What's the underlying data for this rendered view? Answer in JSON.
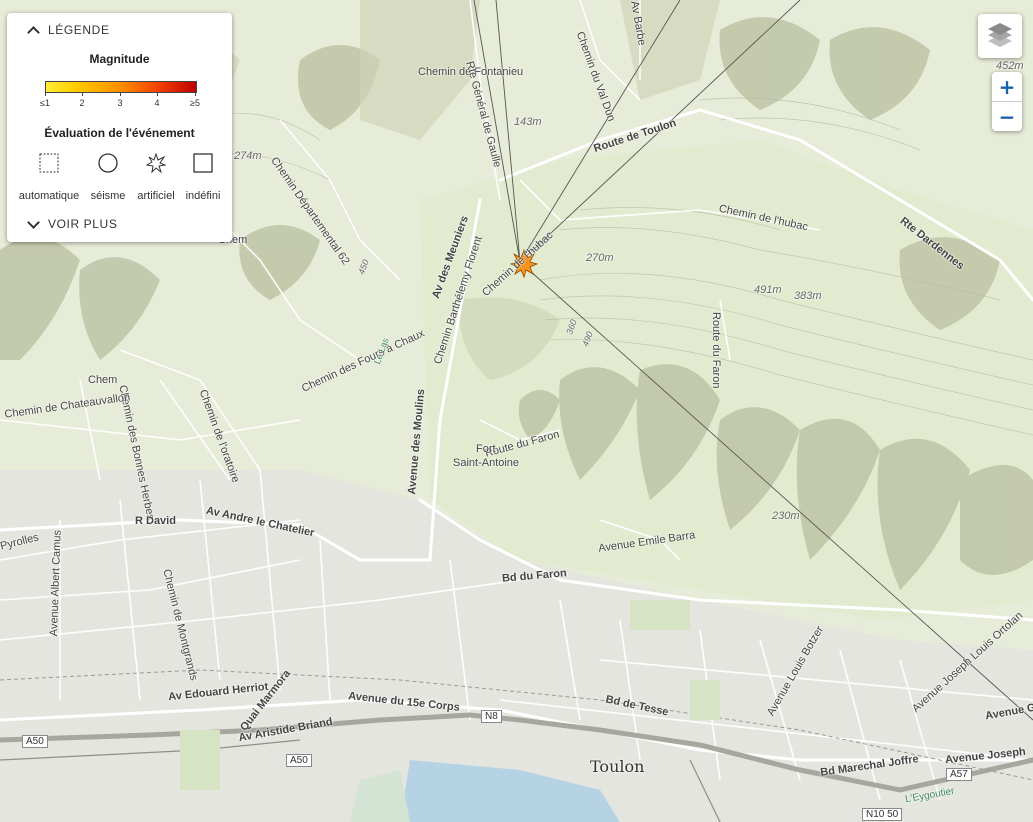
{
  "legend": {
    "toggle_label": "LÉGENDE",
    "magnitude_title": "Magnitude",
    "magnitude_ticks": [
      "≤1",
      "2",
      "3",
      "4",
      "≥5"
    ],
    "evaluation_title": "Évaluation de l'événement",
    "event_types": [
      {
        "label": "automatique",
        "icon": "dotted-square-icon"
      },
      {
        "label": "séisme",
        "icon": "circle-icon"
      },
      {
        "label": "artificiel",
        "icon": "explosion-star-icon"
      },
      {
        "label": "indéfini",
        "icon": "square-icon"
      }
    ],
    "more_label": "VOIR PLUS",
    "colors": {
      "mag_low": "#ffee33",
      "mag_high": "#c00000"
    }
  },
  "controls": {
    "zoom_in": "+",
    "zoom_out": "−",
    "layers_icon": "layers-icon"
  },
  "event": {
    "magnitude": 2.5,
    "type": "artificiel",
    "color": "#f7941d"
  },
  "map_labels": {
    "roads": [
      "Chemin de Fontanieu",
      "Rte Général de Gaulle",
      "Chemin du Val Dun",
      "Av Barbe",
      "Route de Toulon",
      "Chemin Départemental 62",
      "Chemin de l'hubac",
      "Rte Dardennes",
      "Av des Meuniers",
      "Chemin Barthélemy Florent",
      "Chemin de l'hubac",
      "Chemin des Fours à Chaux",
      "Chemin des Bonnes Herbes",
      "Chemin de l'oratoire",
      "Route du Faron",
      "Route du Faron",
      "Avenue des Moulins",
      "R David",
      "Av Andre le Chatelier",
      "Bd du Faron",
      "Avenue Emile Barra",
      "Avenue Albert Camus",
      "Chemin de Montgrands",
      "Av Edouard Herriot",
      "Quai Marmora",
      "Av Aristide Briand",
      "Avenue du 15e Corps",
      "Bd de Tesse",
      "Avenue Louis Botzer",
      "Avenue Joseph Louis Ortolan",
      "Bd Marechal Joffre",
      "Avenue Joseph",
      "Avenue G",
      "Chemin de Chateauvallon",
      "Chem",
      "Pyrolles",
      "Le Las",
      "L'Eygoutier",
      "Chem"
    ],
    "places": [
      "Fort",
      "Saint-Antoine",
      "Toulon"
    ],
    "elevations": [
      "452m",
      "143m",
      "274m",
      "270m",
      "491m",
      "383m",
      "230m",
      "360",
      "490",
      "450"
    ],
    "shields": [
      "A50",
      "A50",
      "N8",
      "A57",
      "N10 50"
    ]
  }
}
